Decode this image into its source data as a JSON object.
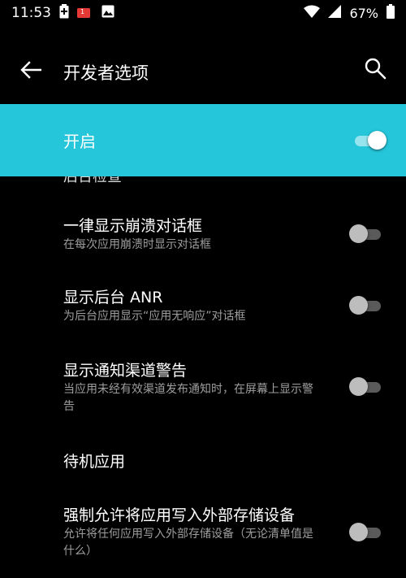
{
  "status_bar": {
    "time": "11:53",
    "battery_percent": "67%",
    "notification_badge": "1",
    "icons": [
      "battery-saver-icon",
      "notification-app-icon",
      "image-icon",
      "wifi-icon",
      "signal-icon",
      "battery-icon"
    ]
  },
  "app_bar": {
    "title": "开发者选项",
    "back_icon": "arrow-left-icon",
    "search_icon": "search-icon"
  },
  "master_switch": {
    "label": "开启",
    "enabled": true
  },
  "settings": {
    "partial_header": "后台检查",
    "items": [
      {
        "title": "一律显示崩溃对话框",
        "subtitle": "在每次应用崩溃时显示对话框",
        "enabled": false
      },
      {
        "title": "显示后台 ANR",
        "subtitle": "为后台应用显示“应用无响应”对话框",
        "enabled": false
      },
      {
        "title": "显示通知渠道警告",
        "subtitle": "当应用未经有效渠道发布通知时，在屏幕上显示警告",
        "enabled": false
      },
      {
        "title": "待机应用"
      },
      {
        "title": "强制允许将应用写入外部存储设备",
        "subtitle": "允许将任何应用写入外部存储设备（无论清单值是什么）",
        "enabled": false
      }
    ]
  },
  "colors": {
    "accent": "#26c6da",
    "background": "#000000",
    "subtitle": "#9e9e9e"
  }
}
